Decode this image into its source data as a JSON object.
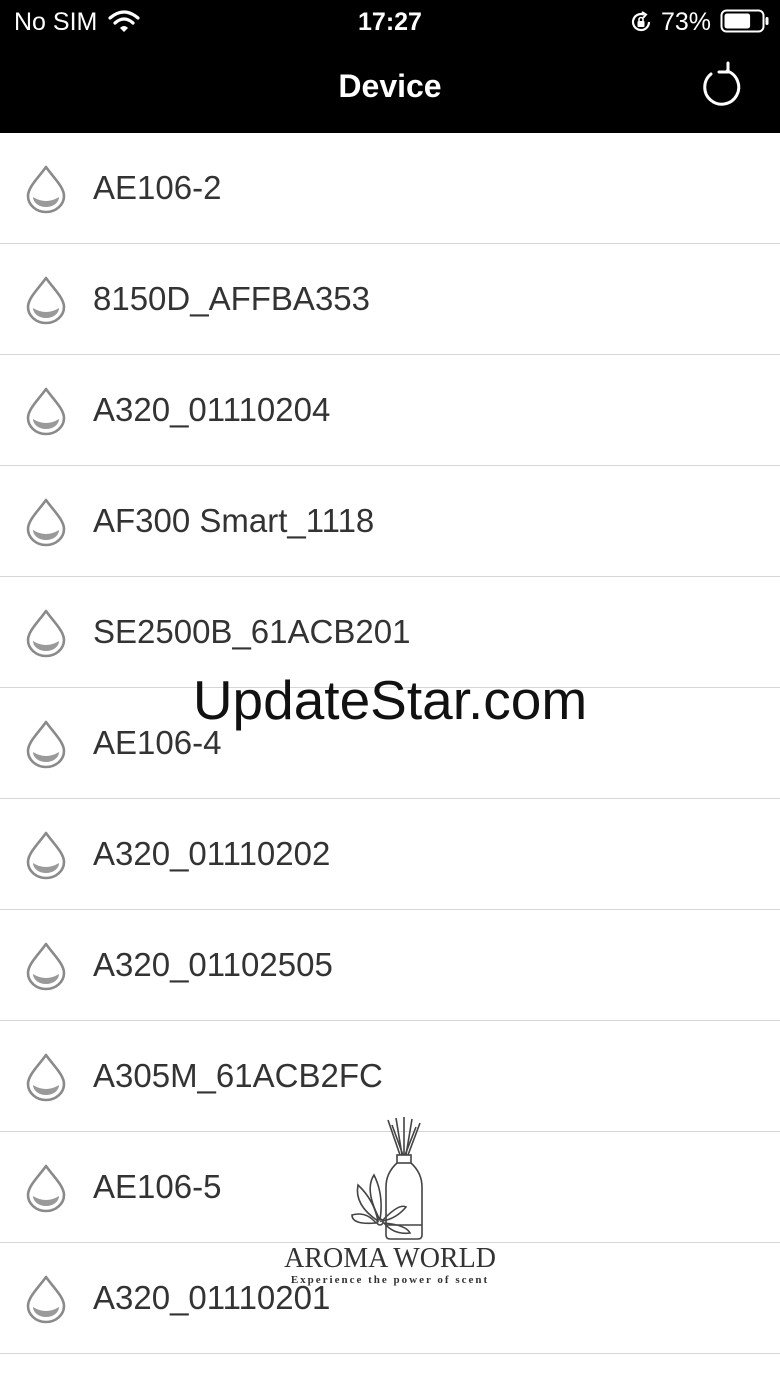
{
  "status_bar": {
    "carrier": "No SIM",
    "time": "17:27",
    "battery_percent": "73%",
    "battery_level": 0.73,
    "icons": [
      "wifi-icon",
      "orientation-lock-icon",
      "battery-icon"
    ]
  },
  "nav": {
    "title": "Device",
    "refresh_icon": "refresh-icon"
  },
  "devices": [
    "AE106-2",
    "8150D_AFFBA353",
    "A320_01110204",
    "AF300 Smart_1118",
    "SE2500B_61ACB201",
    "AE106-4",
    "A320_01110202",
    "A320_01102505",
    "A305M_61ACB2FC",
    "AE106-5",
    "A320_01110201"
  ],
  "device_icon": "droplet-icon",
  "watermark": "UpdateStar.com",
  "logo": {
    "brand": "AROMA WORLD",
    "tagline": "Experience the power of scent"
  },
  "colors": {
    "header_bg": "#000000",
    "header_text": "#ffffff",
    "list_bg": "#ffffff",
    "divider": "#d6d6d6",
    "item_text": "#333333",
    "icon_stroke": "#888888"
  }
}
